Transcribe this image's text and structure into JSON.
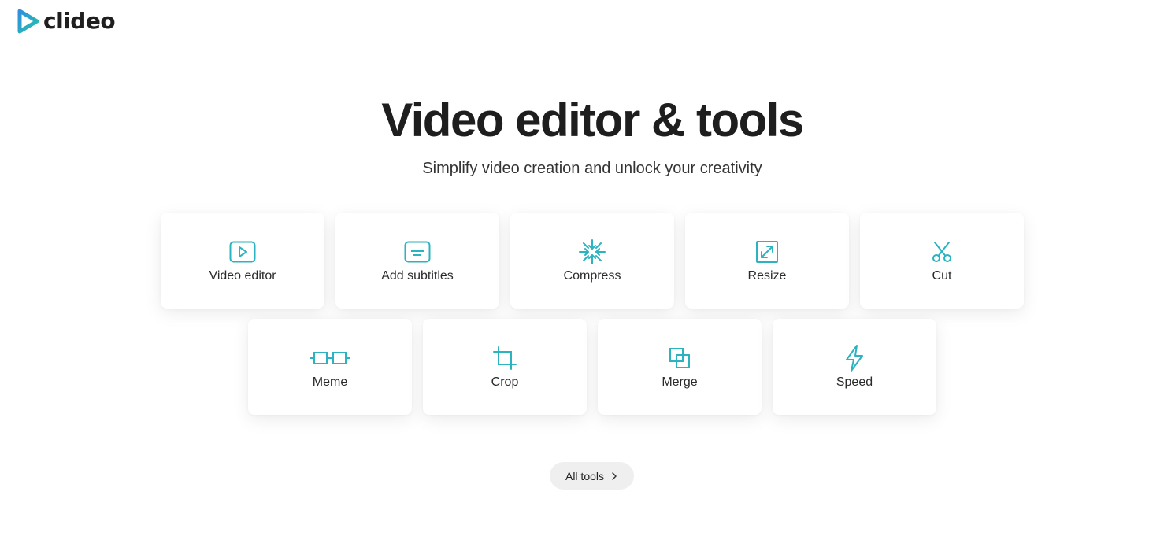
{
  "header": {
    "logo_text": "clideo"
  },
  "hero": {
    "title": "Video editor & tools",
    "subtitle": "Simplify video creation and unlock your creativity"
  },
  "tools": [
    {
      "label": "Video editor",
      "icon": "play-frame-icon"
    },
    {
      "label": "Add subtitles",
      "icon": "subtitles-icon"
    },
    {
      "label": "Compress",
      "icon": "compress-arrows-icon"
    },
    {
      "label": "Resize",
      "icon": "resize-arrows-icon"
    },
    {
      "label": "Cut",
      "icon": "scissors-icon"
    },
    {
      "label": "Meme",
      "icon": "glasses-icon"
    },
    {
      "label": "Crop",
      "icon": "crop-icon"
    },
    {
      "label": "Merge",
      "icon": "merge-squares-icon"
    },
    {
      "label": "Speed",
      "icon": "lightning-icon"
    }
  ],
  "all_tools": {
    "label": "All tools",
    "icon": "chevron-right-icon"
  },
  "colors": {
    "accent": "#2bb3bf",
    "text": "#1e1e1e",
    "pill_bg": "#efefef"
  }
}
